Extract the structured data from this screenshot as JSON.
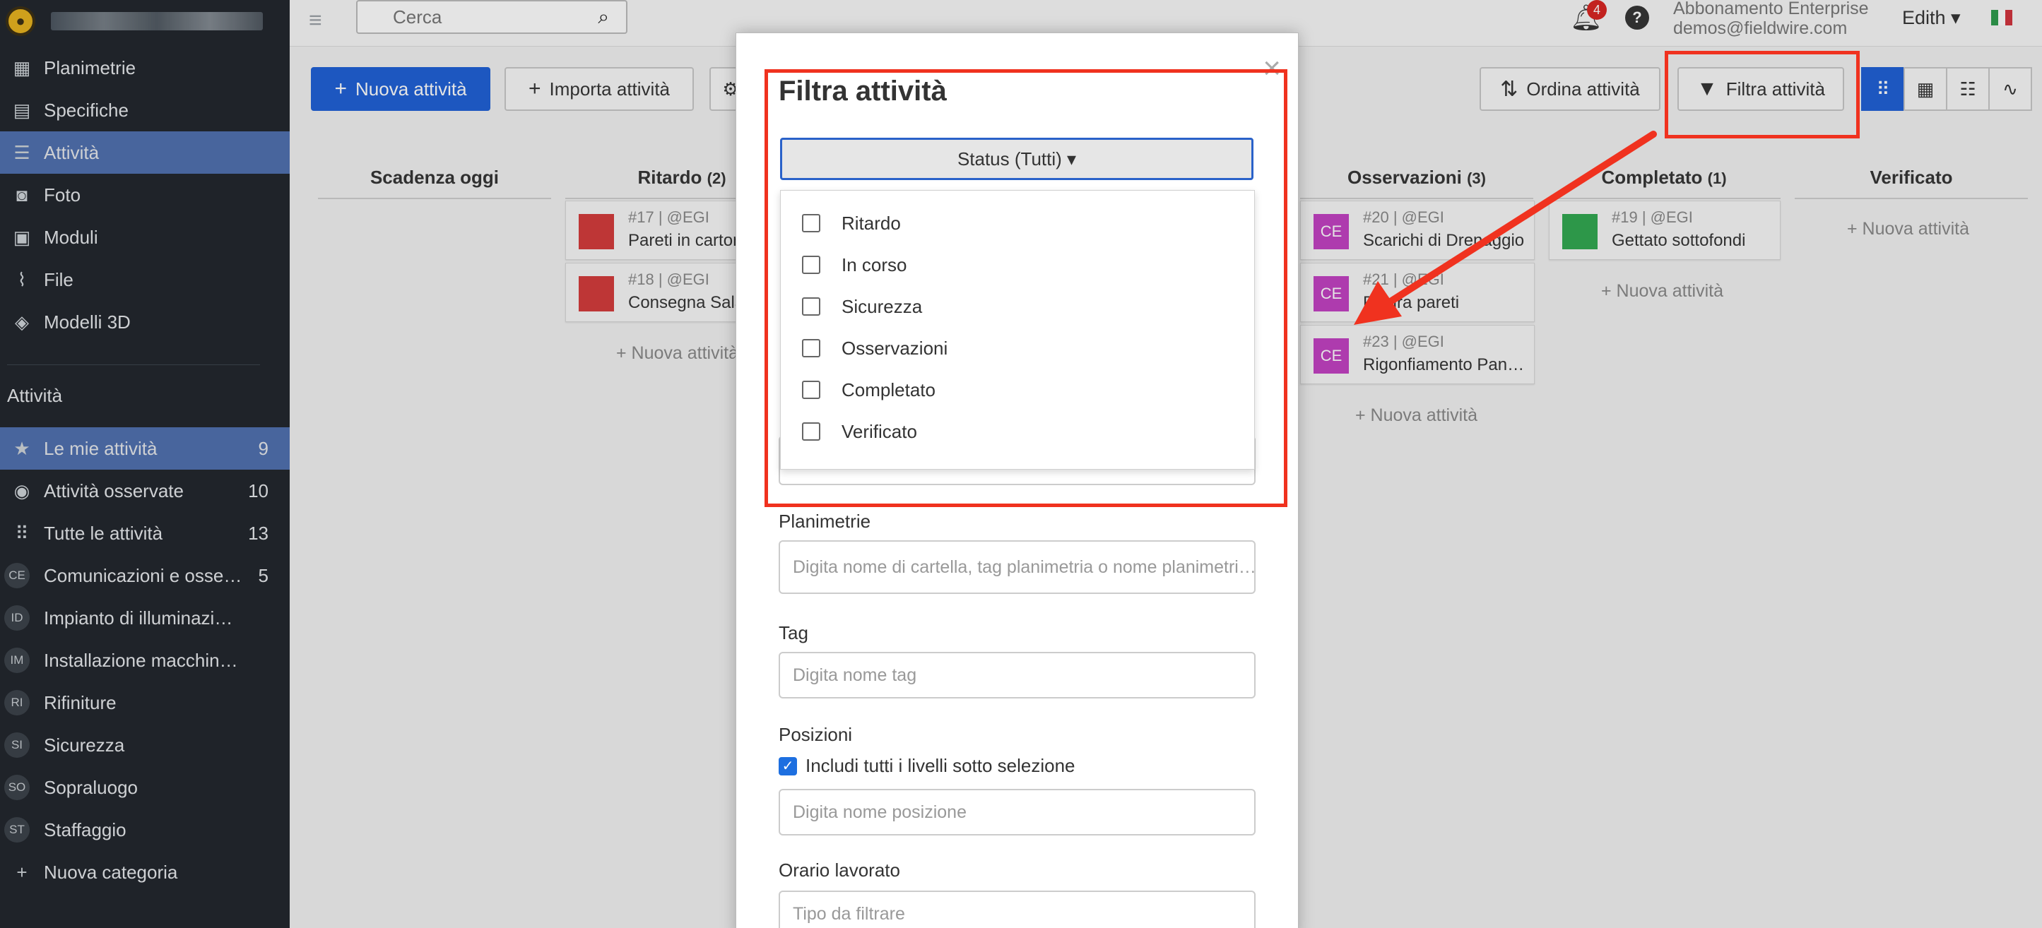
{
  "sidebar": {
    "nav": [
      {
        "label": "Planimetrie",
        "icon": "floorplan-icon"
      },
      {
        "label": "Specifiche",
        "icon": "specs-icon"
      },
      {
        "label": "Attività",
        "icon": "list-icon"
      },
      {
        "label": "Foto",
        "icon": "camera-icon"
      },
      {
        "label": "Moduli",
        "icon": "forms-icon"
      },
      {
        "label": "File",
        "icon": "paperclip-icon"
      },
      {
        "label": "Modelli 3D",
        "icon": "cube-icon"
      }
    ],
    "section_title": "Attività",
    "task_lists": [
      {
        "label": "Le mie attività",
        "count": "9",
        "icon": "star-icon"
      },
      {
        "label": "Attività osservate",
        "count": "10",
        "icon": "eye-icon"
      },
      {
        "label": "Tutte le attività",
        "count": "13",
        "icon": "grid-dots-icon"
      },
      {
        "label": "Comunicazioni e osse…",
        "count": "5",
        "badge": "CE"
      },
      {
        "label": "Impianto di illuminazi…",
        "count": "",
        "badge": "ID"
      },
      {
        "label": "Installazione macchin…",
        "count": "",
        "badge": "IM"
      },
      {
        "label": "Rifiniture",
        "count": "",
        "badge": "RI"
      },
      {
        "label": "Sicurezza",
        "count": "",
        "badge": "SI"
      },
      {
        "label": "Sopraluogo",
        "count": "",
        "badge": "SO"
      },
      {
        "label": "Staffaggio",
        "count": "",
        "badge": "ST"
      },
      {
        "label": "Nuova categoria",
        "count": "",
        "icon": "plus-icon"
      }
    ]
  },
  "topbar": {
    "search_placeholder": "Cerca",
    "notifications_count": "4",
    "help": "?",
    "plan_name": "Abbonamento Enterprise",
    "email": "demos@fieldwire.com",
    "user": "Edith ▾"
  },
  "toolbar": {
    "new_task": "Nuova attività",
    "import_task": "Importa attività",
    "sort_tasks": "Ordina attività",
    "filter_tasks": "Filtra attività"
  },
  "board": {
    "columns": [
      {
        "title": "Scadenza oggi",
        "count": ""
      },
      {
        "title": "Ritardo",
        "count": "(2)"
      },
      {
        "title": "Osservazioni",
        "count": "(3)"
      },
      {
        "title": "Completato",
        "count": "(1)"
      },
      {
        "title": "Verificato",
        "count": ""
      }
    ],
    "cards": [
      {
        "meta": "#17 | @EGI",
        "title": "Pareti in carton",
        "badge": "",
        "color": "#d43a3a"
      },
      {
        "meta": "#18 | @EGI",
        "title": "Consegna Sala",
        "badge": "",
        "color": "#d43a3a"
      },
      {
        "meta": "#20 | @EGI",
        "title": "Scarichi di Drenaggio",
        "badge": "CE",
        "color": "#c23fc2"
      },
      {
        "meta": "#21 | @EGI",
        "title": "Pittura pareti",
        "badge": "CE",
        "color": "#c23fc2"
      },
      {
        "meta": "#23 | @EGI",
        "title": "Rigonfiamento Pan…",
        "badge": "CE",
        "color": "#c23fc2"
      },
      {
        "meta": "#19 | @EGI",
        "title": "Gettato sottofondi",
        "badge": "",
        "color": "#2fa84f"
      }
    ],
    "add_task": "+ Nuova attività"
  },
  "modal": {
    "title": "Filtra attività",
    "status_button": "Status (Tutti) ▾",
    "status_options": [
      "Ritardo",
      "In corso",
      "Sicurezza",
      "Osservazioni",
      "Completato",
      "Verificato"
    ],
    "planimetrie_label": "Planimetrie",
    "planimetrie_placeholder": "Digita nome di cartella, tag planimetria o nome planimetri…",
    "tag_label": "Tag",
    "tag_placeholder": "Digita nome tag",
    "posizioni_label": "Posizioni",
    "include_levels_label": "Includi tutti i livelli sotto selezione",
    "posizione_placeholder": "Digita nome posizione",
    "orario_label": "Orario lavorato",
    "orario_placeholder": "Tipo da filtrare"
  },
  "colors": {
    "sidebar_bg": "#1f242b",
    "active_item": "#4e6faf",
    "primary": "#1d5fd6",
    "annotation_red": "#f0321f"
  }
}
